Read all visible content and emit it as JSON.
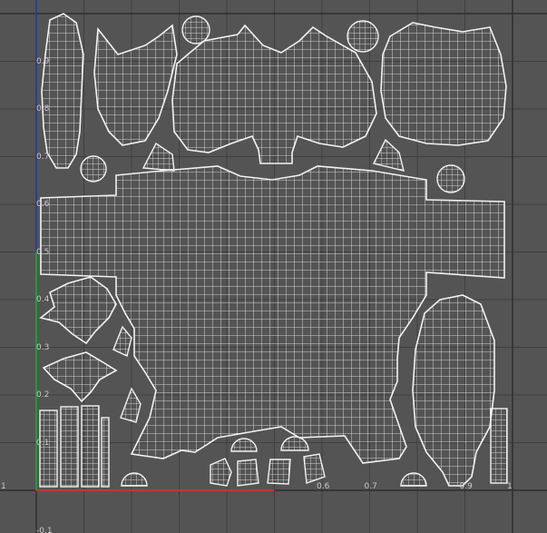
{
  "viewport": {
    "name": "UV Texture Editor",
    "background_color": "#545454",
    "grid_color": "#3f3f3f",
    "border_color": "#2e2e2e",
    "wireframe_color": "#f2f2f2",
    "u_axis_color": "#c0392b",
    "v_axis_color": "#1f9a3a",
    "v_axis_upper_color": "#2d3a9a",
    "u_axis_drawn_to": 0.5
  },
  "u_ticks": [
    {
      "value": 0.6,
      "label": "0.6"
    },
    {
      "value": 0.7,
      "label": "0.7"
    },
    {
      "value": 0.9,
      "label": "0.9"
    },
    {
      "value": 1.0,
      "label": "1"
    }
  ],
  "v_ticks": [
    {
      "value": 0.1,
      "label": "0.1"
    },
    {
      "value": 0.2,
      "label": "0.2"
    },
    {
      "value": 0.3,
      "label": "0.3"
    },
    {
      "value": 0.4,
      "label": "0.4"
    },
    {
      "value": 0.5,
      "label": "0.5"
    },
    {
      "value": 0.6,
      "label": "0.6"
    },
    {
      "value": 0.7,
      "label": "0.7"
    },
    {
      "value": 0.8,
      "label": "0.8"
    },
    {
      "value": 0.9,
      "label": "0.9"
    }
  ],
  "origin_label": "1",
  "bottom_label": "-0.1",
  "uv_shells": [
    {
      "id": "left-arm-strip",
      "kind": "limb"
    },
    {
      "id": "left-shoulder-pad",
      "kind": "armor"
    },
    {
      "id": "right-shoulder-pad",
      "kind": "armor"
    },
    {
      "id": "head",
      "kind": "head"
    },
    {
      "id": "back-plate",
      "kind": "armor"
    },
    {
      "id": "torso",
      "kind": "body"
    },
    {
      "id": "leg",
      "kind": "limb"
    },
    {
      "id": "fin-upper",
      "kind": "detail"
    },
    {
      "id": "fin-lower",
      "kind": "detail"
    },
    {
      "id": "finger-strips",
      "kind": "hand"
    },
    {
      "id": "small-pieces",
      "kind": "detail"
    }
  ]
}
